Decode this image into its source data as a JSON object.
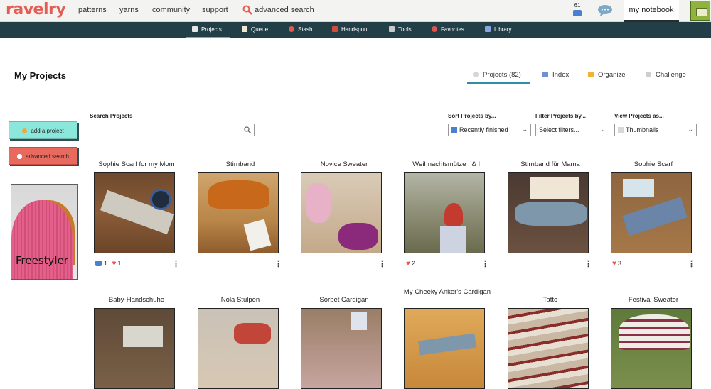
{
  "topbar": {
    "logo": "ravelry",
    "nav": [
      "patterns",
      "yarns",
      "community",
      "support"
    ],
    "advanced_search": "advanced search",
    "mail_count": "61",
    "notebook": "my notebook"
  },
  "subnav": {
    "items": [
      "Projects",
      "Queue",
      "Stash",
      "Handspun",
      "Tools",
      "Favorites",
      "Library"
    ],
    "active": "Projects"
  },
  "page": {
    "title": "My Projects",
    "tabs": [
      "Projects (82)",
      "Index",
      "Organize",
      "Challenge"
    ],
    "active_tab": "Projects (82)"
  },
  "sidebar": {
    "add_project": "add a project",
    "advanced_search": "advanced search",
    "promo_text": "Freestyler"
  },
  "filters": {
    "search_label": "Search Projects",
    "search_value": "",
    "sort_label": "Sort Projects by...",
    "sort_value": "Recently finished",
    "filter_label": "Filter Projects by...",
    "filter_value": "Select filters...",
    "view_label": "View Projects as...",
    "view_value": "Thumbnails"
  },
  "projects": [
    {
      "title": "Sophie Scarf for my Mom",
      "comments": "1",
      "hearts": "1"
    },
    {
      "title": "Stirnband"
    },
    {
      "title": "Novice Sweater"
    },
    {
      "title": "Weihnachtsmütze I & II",
      "hearts": "2"
    },
    {
      "title": "Stirnband für Mama"
    },
    {
      "title": "Sophie Scarf",
      "hearts": "3"
    },
    {
      "title": "Baby-Handschuhe"
    },
    {
      "title": "Nola Stulpen"
    },
    {
      "title": "Sorbet Cardigan"
    },
    {
      "title": "My Cheeky Anker's Cardigan"
    },
    {
      "title": "Tatto"
    },
    {
      "title": "Festival Sweater"
    }
  ],
  "colors": {
    "brand": "#e35d55",
    "subnav_bg": "#223f48",
    "add_button": "#8be6dc",
    "advanced_button": "#e86a5f",
    "heart": "#e0534e",
    "comment": "#4b7fcf"
  }
}
